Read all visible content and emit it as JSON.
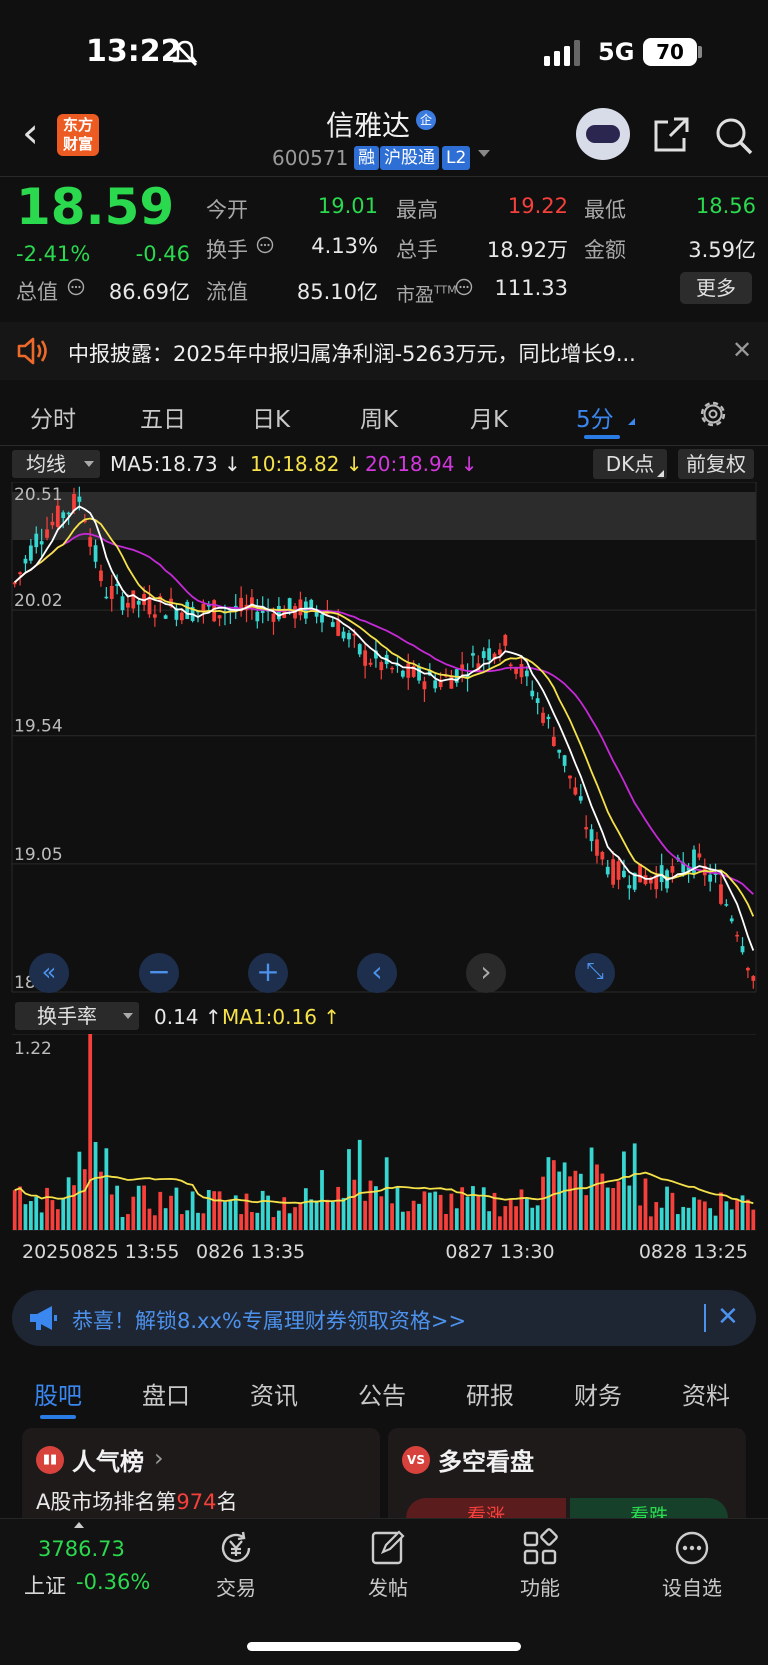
{
  "status_bar": {
    "time": "13:22",
    "network": "5G",
    "battery": "70"
  },
  "header": {
    "logo_text_1": "东方",
    "logo_text_2": "财富",
    "stock_name": "信雅达",
    "badge": "企",
    "stock_code": "600571",
    "tags": [
      "融",
      "沪股通",
      "L2"
    ]
  },
  "quote": {
    "price": "18.59",
    "change_pct": "-2.41%",
    "change": "-0.46",
    "fields": [
      {
        "label": "今开",
        "value": "19.01"
      },
      {
        "label": "最高",
        "value": "19.22"
      },
      {
        "label": "最低",
        "value": "18.56"
      },
      {
        "label": "换手",
        "value": "4.13%"
      },
      {
        "label": "总手",
        "value": "18.92万"
      },
      {
        "label": "金额",
        "value": "3.59亿"
      },
      {
        "label": "总值",
        "value": "86.69亿"
      },
      {
        "label": "流值",
        "value": "85.10亿"
      },
      {
        "label": "市盈",
        "value": "111.33",
        "sup": "TTM"
      }
    ],
    "more_label": "更多"
  },
  "notice": {
    "text": "中报披露：2025年中报归属净利润-5263万元，同比增长9...",
    "close": "✕"
  },
  "period_tabs": [
    "分时",
    "五日",
    "日K",
    "周K",
    "月K",
    "5分"
  ],
  "period_tabs_active": "5分",
  "indicator": {
    "select": "均线",
    "ma5": "MA5:18.73",
    "ma10": "10:18.82",
    "ma20": "20:18.94",
    "dk_label": "DK点",
    "fq_label": "前复权"
  },
  "volume": {
    "select": "换手率",
    "value": "0.14",
    "ma1": "MA1:0.16",
    "max_label": "1.22"
  },
  "x_labels": [
    "20250825 13:55",
    "0826 13:35",
    "0827 13:30",
    "0828 13:25"
  ],
  "chart_data": {
    "type": "candlestick",
    "price_labels": [
      "20.51",
      "20.02",
      "19.54",
      "19.05",
      "18.56"
    ],
    "ylim": [
      18.56,
      20.51
    ],
    "volume_ylim": [
      0,
      1.22
    ],
    "colors": {
      "up": "#f5403b",
      "down": "#37d6d0",
      "ma5": "#ffffff",
      "ma10": "#f5e24a",
      "ma20": "#c52ad6"
    }
  },
  "banner": {
    "text": "恭喜！解锁8.xx%专属理财券领取资格>>",
    "close": "✕"
  },
  "bottom_tabs": [
    "股吧",
    "盘口",
    "资讯",
    "公告",
    "研报",
    "财务",
    "资料"
  ],
  "bottom_tabs_active": "股吧",
  "cards": {
    "hot": {
      "icon": "▮▮",
      "title": "人气榜",
      "text_prefix": "A股市场排名第",
      "rank": "974",
      "text_suffix": "名"
    },
    "longshort": {
      "icon": "VS",
      "title": "多空看盘",
      "up": "看涨",
      "down": "看跌"
    }
  },
  "bottom_nav": {
    "index_value": "3786.73",
    "index_name": "上证",
    "index_change": "-0.36%",
    "items": [
      "交易",
      "发帖",
      "功能",
      "设自选"
    ]
  }
}
